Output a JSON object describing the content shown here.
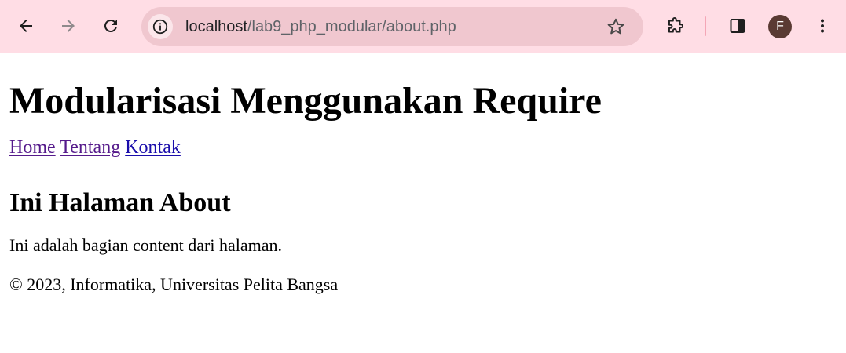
{
  "browser": {
    "url_host": "localhost",
    "url_path": "/lab9_php_modular/about.php",
    "profile_initial": "F",
    "accent": "#ffdde5"
  },
  "page": {
    "title": "Modularisasi Menggunakan Require",
    "nav": [
      "Home",
      "Tentang",
      "Kontak"
    ],
    "heading": "Ini Halaman About",
    "content": "Ini adalah bagian content dari halaman.",
    "footer": "© 2023, Informatika, Universitas Pelita Bangsa"
  }
}
